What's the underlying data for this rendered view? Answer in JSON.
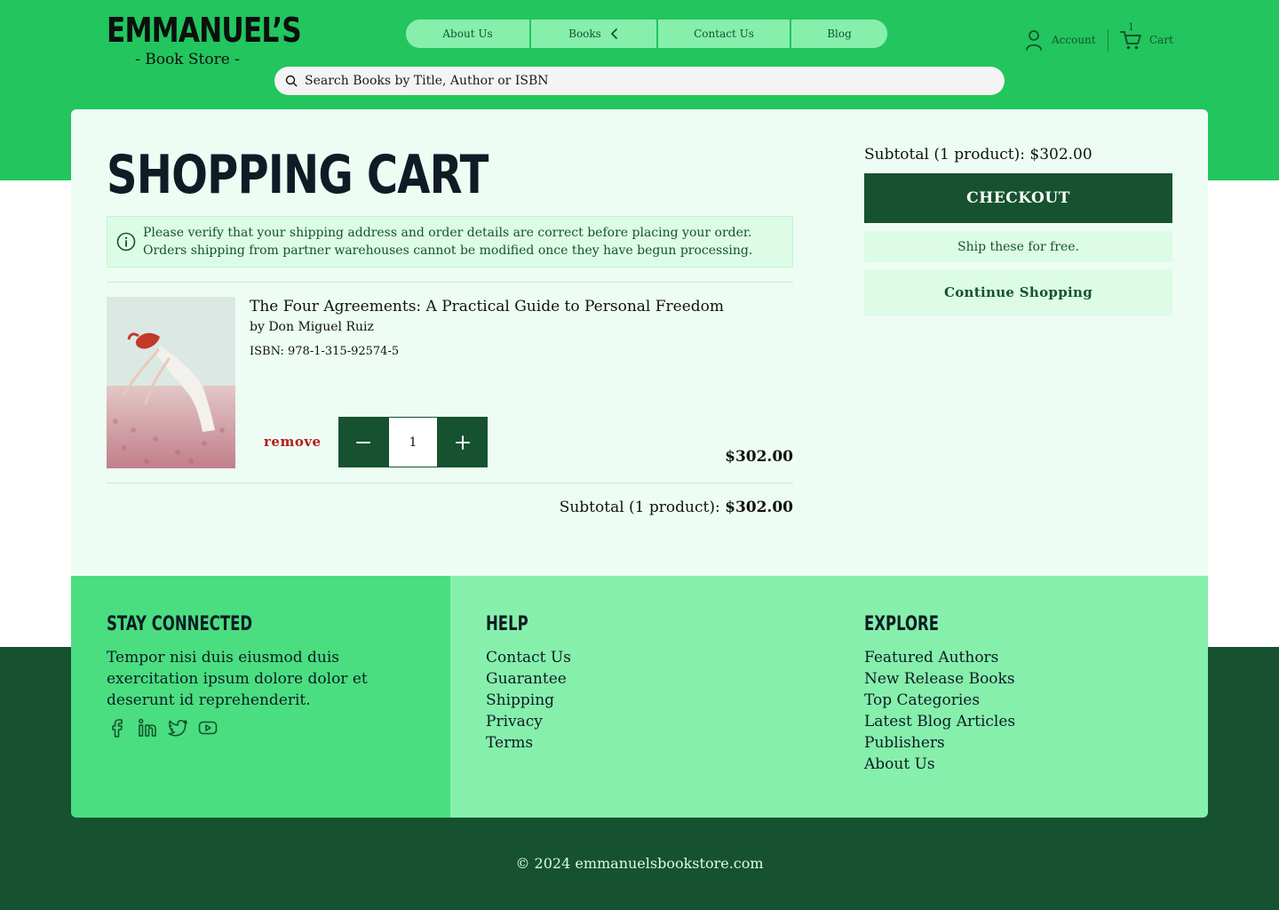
{
  "header": {
    "logo_title": "EMMANUEL’S",
    "logo_sub": "- Book Store -",
    "nav": {
      "about": "About Us",
      "books": "Books",
      "contact": "Contact Us",
      "blog": "Blog"
    },
    "search_placeholder": "Search Books by Title, Author or ISBN",
    "account_label": "Account",
    "cart_label": "Cart",
    "cart_count": "1"
  },
  "cart": {
    "title": "Shopping Cart",
    "notice_line1": "Please verify that your shipping address and order details are correct before placing your order.",
    "notice_line2": "Orders shipping from partner warehouses cannot be modified once they have begun processing.",
    "items": [
      {
        "title": "The Four Agreements: A Practical Guide to Personal Freedom",
        "author": "by Don Miguel Ruiz",
        "isbn": "ISBN: 978-1-315-92574-5",
        "remove_label": "remove",
        "quantity": "1",
        "price": "$302.00"
      }
    ],
    "subtotal_label": "Subtotal (1 product):",
    "subtotal_value": "$302.00"
  },
  "summary": {
    "subtotal": "Subtotal (1 product): $302.00",
    "checkout_label": "CHECKOUT",
    "free_shipping": "Ship these for free.",
    "continue_label": "Continue Shopping"
  },
  "footer": {
    "stay_connected": {
      "heading": "STAY CONNECTED",
      "text": "Tempor nisi duis eiusmod duis exercitation ipsum dolore dolor et deserunt id reprehenderit.",
      "social_icons": [
        "facebook-icon",
        "linkedin-icon",
        "twitter-icon",
        "youtube-icon"
      ]
    },
    "help": {
      "heading": "HELP",
      "links": [
        "Contact Us",
        "Guarantee",
        "Shipping",
        "Privacy",
        "Terms"
      ]
    },
    "explore": {
      "heading": "EXPLORE",
      "links": [
        "Featured Authors",
        "New Release Books",
        "Top Categories",
        "Latest Blog Articles",
        "Publishers",
        "About Us"
      ]
    },
    "copyright": "© 2024 emmanuelsbookstore.com"
  },
  "colors": {
    "brand_green": "#22c55e",
    "dark_green": "#165230",
    "light_green": "#86efac",
    "mid_green": "#4ade80",
    "pale_green": "#edfdf3",
    "remove_red": "#b91c1c"
  }
}
